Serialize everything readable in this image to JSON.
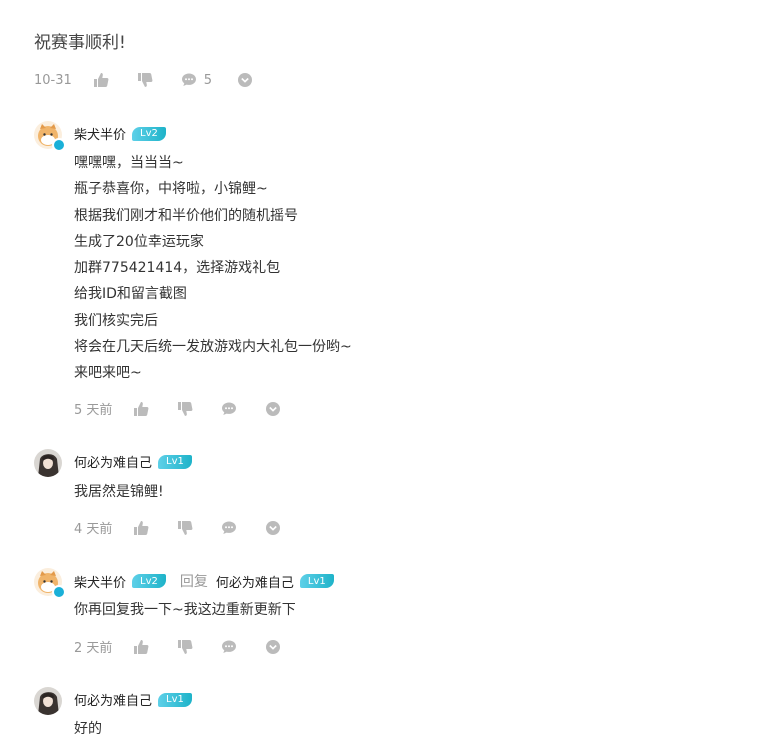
{
  "top_comment": {
    "text": "祝赛事顺利!",
    "time": "10-31",
    "reply_count": "5"
  },
  "replies": [
    {
      "user": "柴犬半价",
      "level": "Lv2",
      "lines": [
        "嘿嘿嘿，当当当~",
        "瓶子恭喜你，中将啦，小锦鲤~",
        "根据我们刚才和半价他们的随机摇号",
        "生成了20位幸运玩家",
        "加群775421414，选择游戏礼包",
        "给我ID和留言截图",
        "我们核实完后",
        "将会在几天后统一发放游戏内大礼包一份哟~",
        "来吧来吧~"
      ],
      "time": "5 天前"
    },
    {
      "user": "何必为难自己",
      "level": "Lv1",
      "lines": [
        "我居然是锦鲤!"
      ],
      "time": "4 天前"
    },
    {
      "user": "柴犬半价",
      "level": "Lv2",
      "reply_word": "回复",
      "reply_to": "何必为难自己",
      "reply_to_level": "Lv1",
      "lines": [
        "你再回复我一下~我这边重新更新下"
      ],
      "time": "2 天前"
    },
    {
      "user": "何必为难自己",
      "level": "Lv1",
      "lines": [
        "好的"
      ]
    }
  ],
  "colors": {
    "level_badge": "#1eb3c9",
    "verified": "#1ab0d8",
    "muted": "#999999"
  },
  "icons": [
    "thumbs-up-icon",
    "thumbs-down-icon",
    "comment-icon",
    "more-icon"
  ]
}
